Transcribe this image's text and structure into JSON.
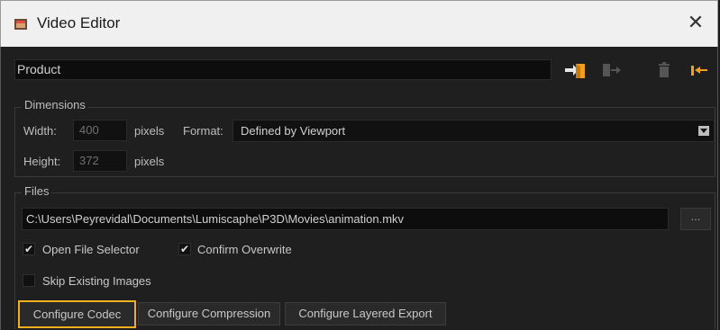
{
  "window": {
    "title": "Video Editor",
    "close_glyph": "✕"
  },
  "product": {
    "value": "Product"
  },
  "toolbar": {
    "icons": [
      "import-arrow-icon",
      "export-icon",
      "trash-icon",
      "collapse-arrow-icon"
    ],
    "accent_color": "#f0a020"
  },
  "dimensions": {
    "title": "Dimensions",
    "width_label": "Width:",
    "width_value": "400",
    "height_label": "Height:",
    "height_value": "372",
    "unit": "pixels",
    "format_label": "Format:",
    "format_value": "Defined by Viewport"
  },
  "files": {
    "title": "Files",
    "path": "C:\\Users\\Peyrevidal\\Documents\\Lumiscaphe\\P3D\\Movies\\animation.mkv",
    "browse_label": "...",
    "open_file_selector": {
      "label": "Open File Selector",
      "checked": true
    },
    "confirm_overwrite": {
      "label": "Confirm Overwrite",
      "checked": true
    },
    "skip_existing": {
      "label": "Skip Existing Images",
      "checked": false
    }
  },
  "buttons": {
    "configure_codec": "Configure Codec",
    "configure_compression": "Configure Compression",
    "configure_layered_export": "Configure Layered Export"
  },
  "focus_color": "#f0b020",
  "check_glyph": "✔"
}
